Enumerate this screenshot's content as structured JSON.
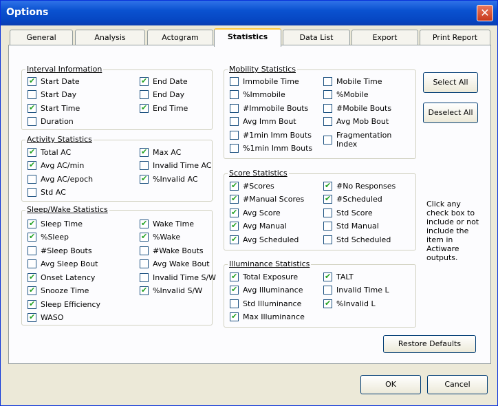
{
  "window": {
    "title": "Options",
    "close": "✕"
  },
  "tabs": [
    "General",
    "Analysis",
    "Actogram",
    "Statistics",
    "Data List",
    "Export",
    "Print Report"
  ],
  "interval": {
    "title": "Interval Information",
    "items": [
      {
        "label": "Start Date",
        "checked": true
      },
      {
        "label": "Start Day",
        "checked": false
      },
      {
        "label": "Start Time",
        "checked": true
      },
      {
        "label": "Duration",
        "checked": false
      },
      {
        "label": "End Date",
        "checked": true
      },
      {
        "label": "End Day",
        "checked": false
      },
      {
        "label": "End Time",
        "checked": true
      }
    ]
  },
  "activity": {
    "title": "Activity Statistics",
    "items": [
      {
        "label": "Total AC",
        "checked": true
      },
      {
        "label": "Avg AC/min",
        "checked": true
      },
      {
        "label": "Avg AC/epoch",
        "checked": false
      },
      {
        "label": "Std AC",
        "checked": false
      },
      {
        "label": "Max AC",
        "checked": true
      },
      {
        "label": "Invalid Time AC",
        "checked": false
      },
      {
        "label": "%Invalid AC",
        "checked": true
      }
    ]
  },
  "sleep": {
    "title": "Sleep/Wake Statistics",
    "items": [
      {
        "label": "Sleep Time",
        "checked": true
      },
      {
        "label": "%Sleep",
        "checked": true
      },
      {
        "label": "#Sleep Bouts",
        "checked": false
      },
      {
        "label": "Avg Sleep Bout",
        "checked": false
      },
      {
        "label": "Onset Latency",
        "checked": true
      },
      {
        "label": "Snooze Time",
        "checked": true
      },
      {
        "label": "Sleep Efficiency",
        "checked": true
      },
      {
        "label": "WASO",
        "checked": true
      },
      {
        "label": "Wake Time",
        "checked": true
      },
      {
        "label": "%Wake",
        "checked": true
      },
      {
        "label": "#Wake Bouts",
        "checked": false
      },
      {
        "label": "Avg Wake Bout",
        "checked": false
      },
      {
        "label": "Invalid Time S/W",
        "checked": false
      },
      {
        "label": "%Invalid S/W",
        "checked": true
      }
    ]
  },
  "mobility": {
    "title": "Mobility Statistics",
    "items": [
      {
        "label": "Immobile Time",
        "checked": false
      },
      {
        "label": "%Immobile",
        "checked": false
      },
      {
        "label": "#Immobile Bouts",
        "checked": false
      },
      {
        "label": "Avg Imm Bout",
        "checked": false
      },
      {
        "label": "#1min Imm Bouts",
        "checked": false
      },
      {
        "label": "%1min Imm Bouts",
        "checked": false
      },
      {
        "label": "Mobile Time",
        "checked": false
      },
      {
        "label": "%Mobile",
        "checked": false
      },
      {
        "label": "#Mobile Bouts",
        "checked": false
      },
      {
        "label": "Avg Mob Bout",
        "checked": false
      },
      {
        "label": "Fragmentation Index",
        "checked": false
      }
    ]
  },
  "score": {
    "title": "Score Statistics",
    "items": [
      {
        "label": "#Scores",
        "checked": true
      },
      {
        "label": "#Manual Scores",
        "checked": true
      },
      {
        "label": "Avg Score",
        "checked": true
      },
      {
        "label": "Avg Manual",
        "checked": true
      },
      {
        "label": "Avg Scheduled",
        "checked": true
      },
      {
        "label": "#No Responses",
        "checked": true
      },
      {
        "label": "#Scheduled",
        "checked": true
      },
      {
        "label": "Std Score",
        "checked": false
      },
      {
        "label": "Std Manual",
        "checked": false
      },
      {
        "label": "Std Scheduled",
        "checked": false
      }
    ]
  },
  "illum": {
    "title": "Illuminance Statistics",
    "items": [
      {
        "label": "Total Exposure",
        "checked": true
      },
      {
        "label": "Avg Illuminance",
        "checked": true
      },
      {
        "label": "Std Illuminance",
        "checked": false
      },
      {
        "label": "Max Illuminance",
        "checked": true
      },
      {
        "label": "TALT",
        "checked": true
      },
      {
        "label": "Invalid Time L",
        "checked": false
      },
      {
        "label": "%Invalid L",
        "checked": true
      }
    ]
  },
  "buttons": {
    "select_all": "Select All",
    "deselect_all": "Deselect All",
    "restore": "Restore Defaults",
    "ok": "OK",
    "cancel": "Cancel"
  },
  "note": "Click any check box to include or not include the item in Actiware outputs."
}
